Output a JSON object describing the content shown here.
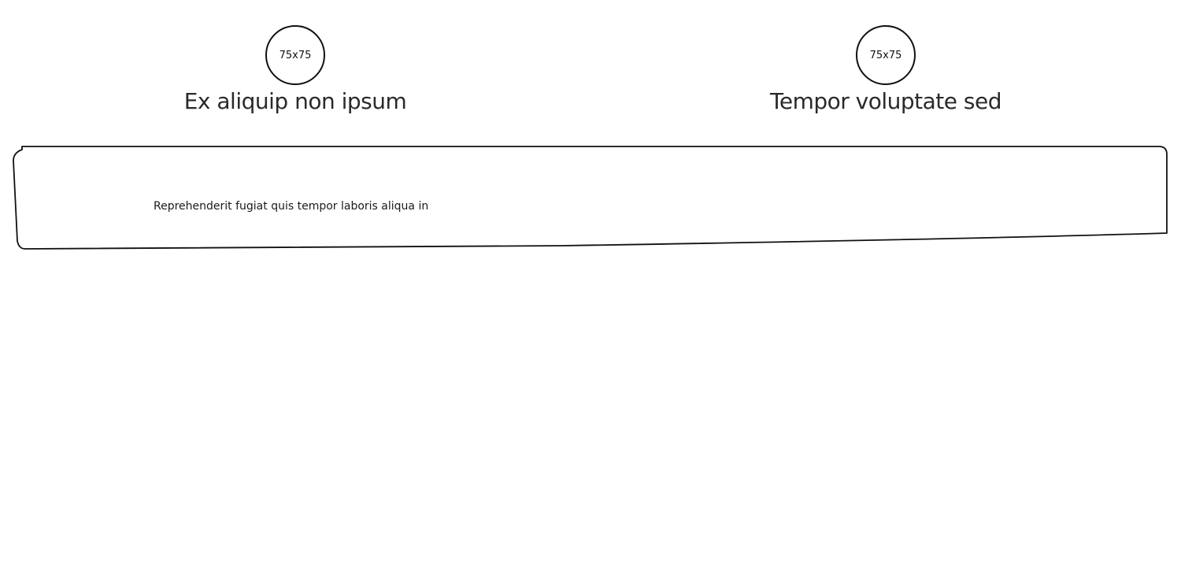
{
  "features": [
    {
      "image_placeholder": "75x75",
      "title": "Ex aliquip non ipsum"
    },
    {
      "image_placeholder": "75x75",
      "title": "Tempor voluptate sed"
    }
  ],
  "panel": {
    "text": "Reprehenderit fugiat quis tempor laboris aliqua in"
  }
}
